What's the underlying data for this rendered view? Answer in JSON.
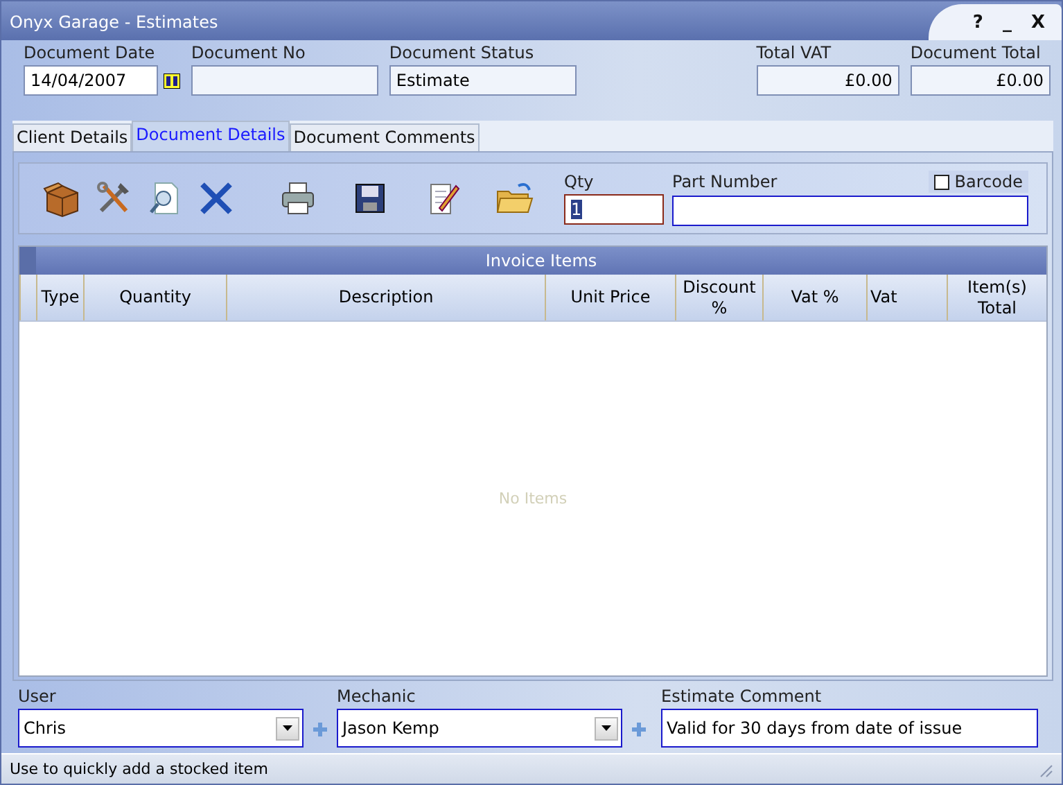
{
  "window": {
    "title": "Onyx Garage - Estimates",
    "controls": [
      "?",
      "_",
      "X"
    ]
  },
  "header_fields": [
    {
      "kind": "date",
      "label": "Document Date",
      "value": "14/04/2007"
    },
    {
      "kind": "readonly",
      "label": "Document No"
    },
    {
      "kind": "readonly",
      "label": "Document Status",
      "value": "Estimate"
    },
    {
      "kind": "money",
      "label": "Total VAT",
      "value": "£0.00"
    },
    {
      "kind": "money",
      "label": "Document Total",
      "value": "£0.00"
    }
  ],
  "tabs": [
    {
      "label": "Client Details",
      "selected": false
    },
    {
      "label": "Document Details",
      "selected": true
    },
    {
      "label": "Document Comments",
      "selected": false
    }
  ],
  "toolbar": {
    "qty": {
      "label": "Qty",
      "value": "1"
    },
    "part_number": {
      "label": "Part Number"
    },
    "barcode": {
      "label": "Barcode",
      "checked": false
    }
  },
  "table": {
    "title": "Invoice Items",
    "columns": [
      "Type",
      "Quantity",
      "Description",
      "Unit Price",
      "Discount %",
      "Vat %",
      "Vat",
      "Item(s) Total"
    ],
    "empty_message": "No Items"
  },
  "footer": [
    {
      "kind": "combo",
      "label": "User",
      "value": "Chris"
    },
    {
      "kind": "combo",
      "label": "Mechanic",
      "value": "Jason Kemp"
    },
    {
      "kind": "text",
      "label": "Estimate Comment",
      "value": "Valid for 30 days from date of issue"
    }
  ],
  "status_bar": "Use to quickly add a stocked item"
}
